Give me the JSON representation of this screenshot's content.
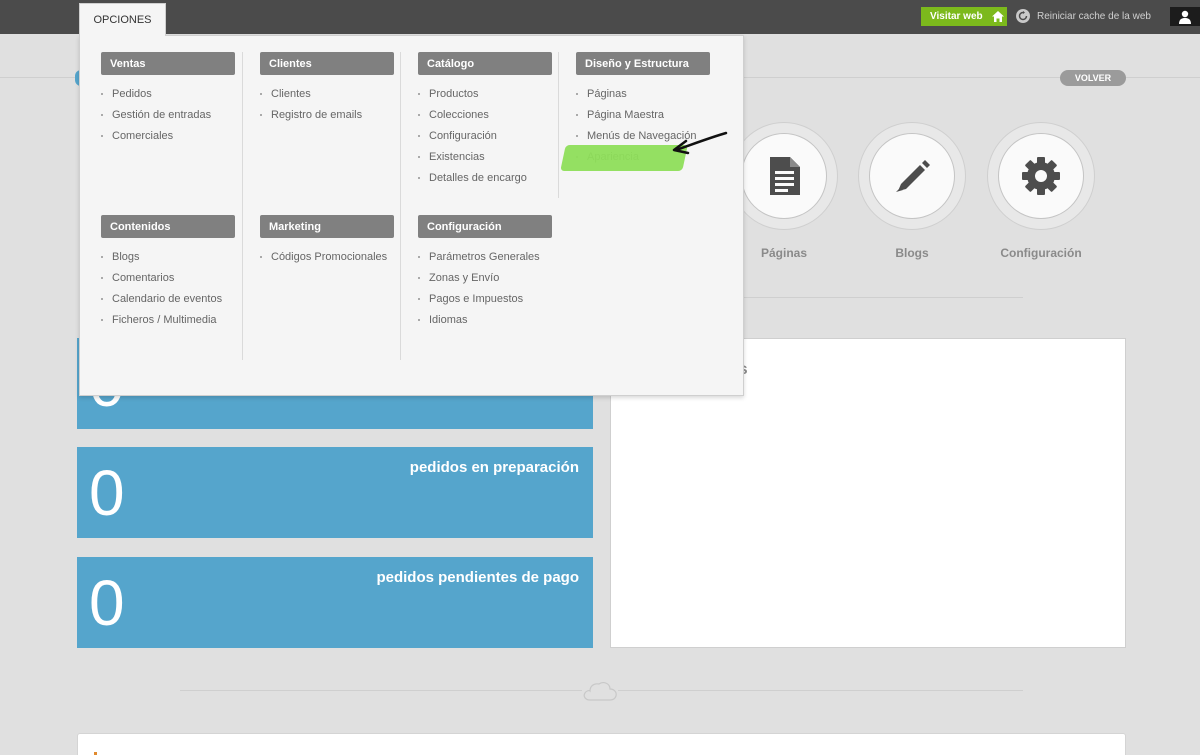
{
  "topbar": {
    "opciones_label": "OPCIONES",
    "visit_label": "Visitar web",
    "cache_label": "Reiniciar cache de la web"
  },
  "page": {
    "volver_label": "VOLVER",
    "shortcuts": [
      {
        "label": "Páginas",
        "icon": "document-icon"
      },
      {
        "label": "Blogs",
        "icon": "pencil-icon"
      },
      {
        "label": "Configuración",
        "icon": "gear-icon"
      }
    ],
    "stats": [
      {
        "number": "0",
        "label": "pedidos en preparación"
      },
      {
        "number": "0",
        "label": "pedidos pendientes de pago"
      }
    ],
    "panel_title_fragment": "os"
  },
  "menu": {
    "groups": [
      {
        "title": "Ventas",
        "items": [
          "Pedidos",
          "Gestión de entradas",
          "Comerciales"
        ]
      },
      {
        "title": "Clientes",
        "items": [
          "Clientes",
          "Registro de emails"
        ]
      },
      {
        "title": "Catálogo",
        "items": [
          "Productos",
          "Colecciones",
          "Configuración",
          "Existencias",
          "Detalles de encargo"
        ]
      },
      {
        "title": "Diseño y Estructura",
        "items": [
          "Páginas",
          "Página Maestra",
          "Menús de Navegación",
          "Apariencia"
        ]
      },
      {
        "title": "Contenidos",
        "items": [
          "Blogs",
          "Comentarios",
          "Calendario de eventos",
          "Ficheros / Multimedia"
        ]
      },
      {
        "title": "Marketing",
        "items": [
          "Códigos Promocionales"
        ]
      },
      {
        "title": "Configuración",
        "items": [
          "Parámetros Generales",
          "Zonas y Envío",
          "Pagos e Impuestos",
          "Idiomas"
        ]
      }
    ]
  },
  "colors": {
    "topbar": "#4b4b4b",
    "visit_button": "#7cb91c",
    "stat_blue": "#55a5cc",
    "highlight_green": "#8ede5a",
    "menu_header": "#808080"
  }
}
